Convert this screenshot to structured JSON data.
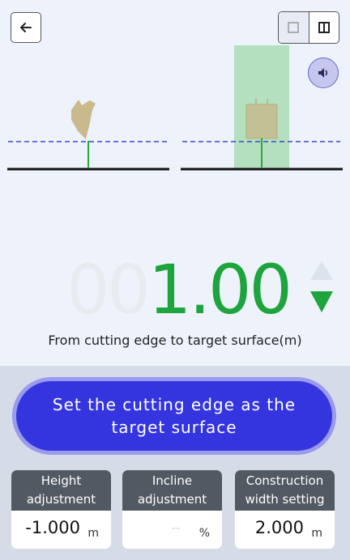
{
  "top_bar": {
    "back_icon": "arrow-left-icon",
    "view_toggle": {
      "single_icon": "square-icon",
      "split_icon": "split-view-icon",
      "active": "split"
    },
    "sound_icon": "speaker-icon"
  },
  "readout": {
    "leading_digits": "00",
    "value": "1.00",
    "caption": "From cutting edge to target surface(m)",
    "up_icon": "triangle-up-icon",
    "down_icon": "triangle-down-icon"
  },
  "actions": {
    "set_target": "Set the cutting edge as the target surface"
  },
  "settings": [
    {
      "label": "Height adjustment",
      "value": "-1.000",
      "unit": "m"
    },
    {
      "label": "Incline adjustment",
      "value": "--",
      "unit": "%"
    },
    {
      "label": "Construction width setting",
      "value": "2.000",
      "unit": "m"
    }
  ],
  "colors": {
    "accent_green": "#1ea43d",
    "button_blue": "#3535e0",
    "guide_blue": "#3b45c8",
    "bucket_tan": "#c9b98c"
  }
}
